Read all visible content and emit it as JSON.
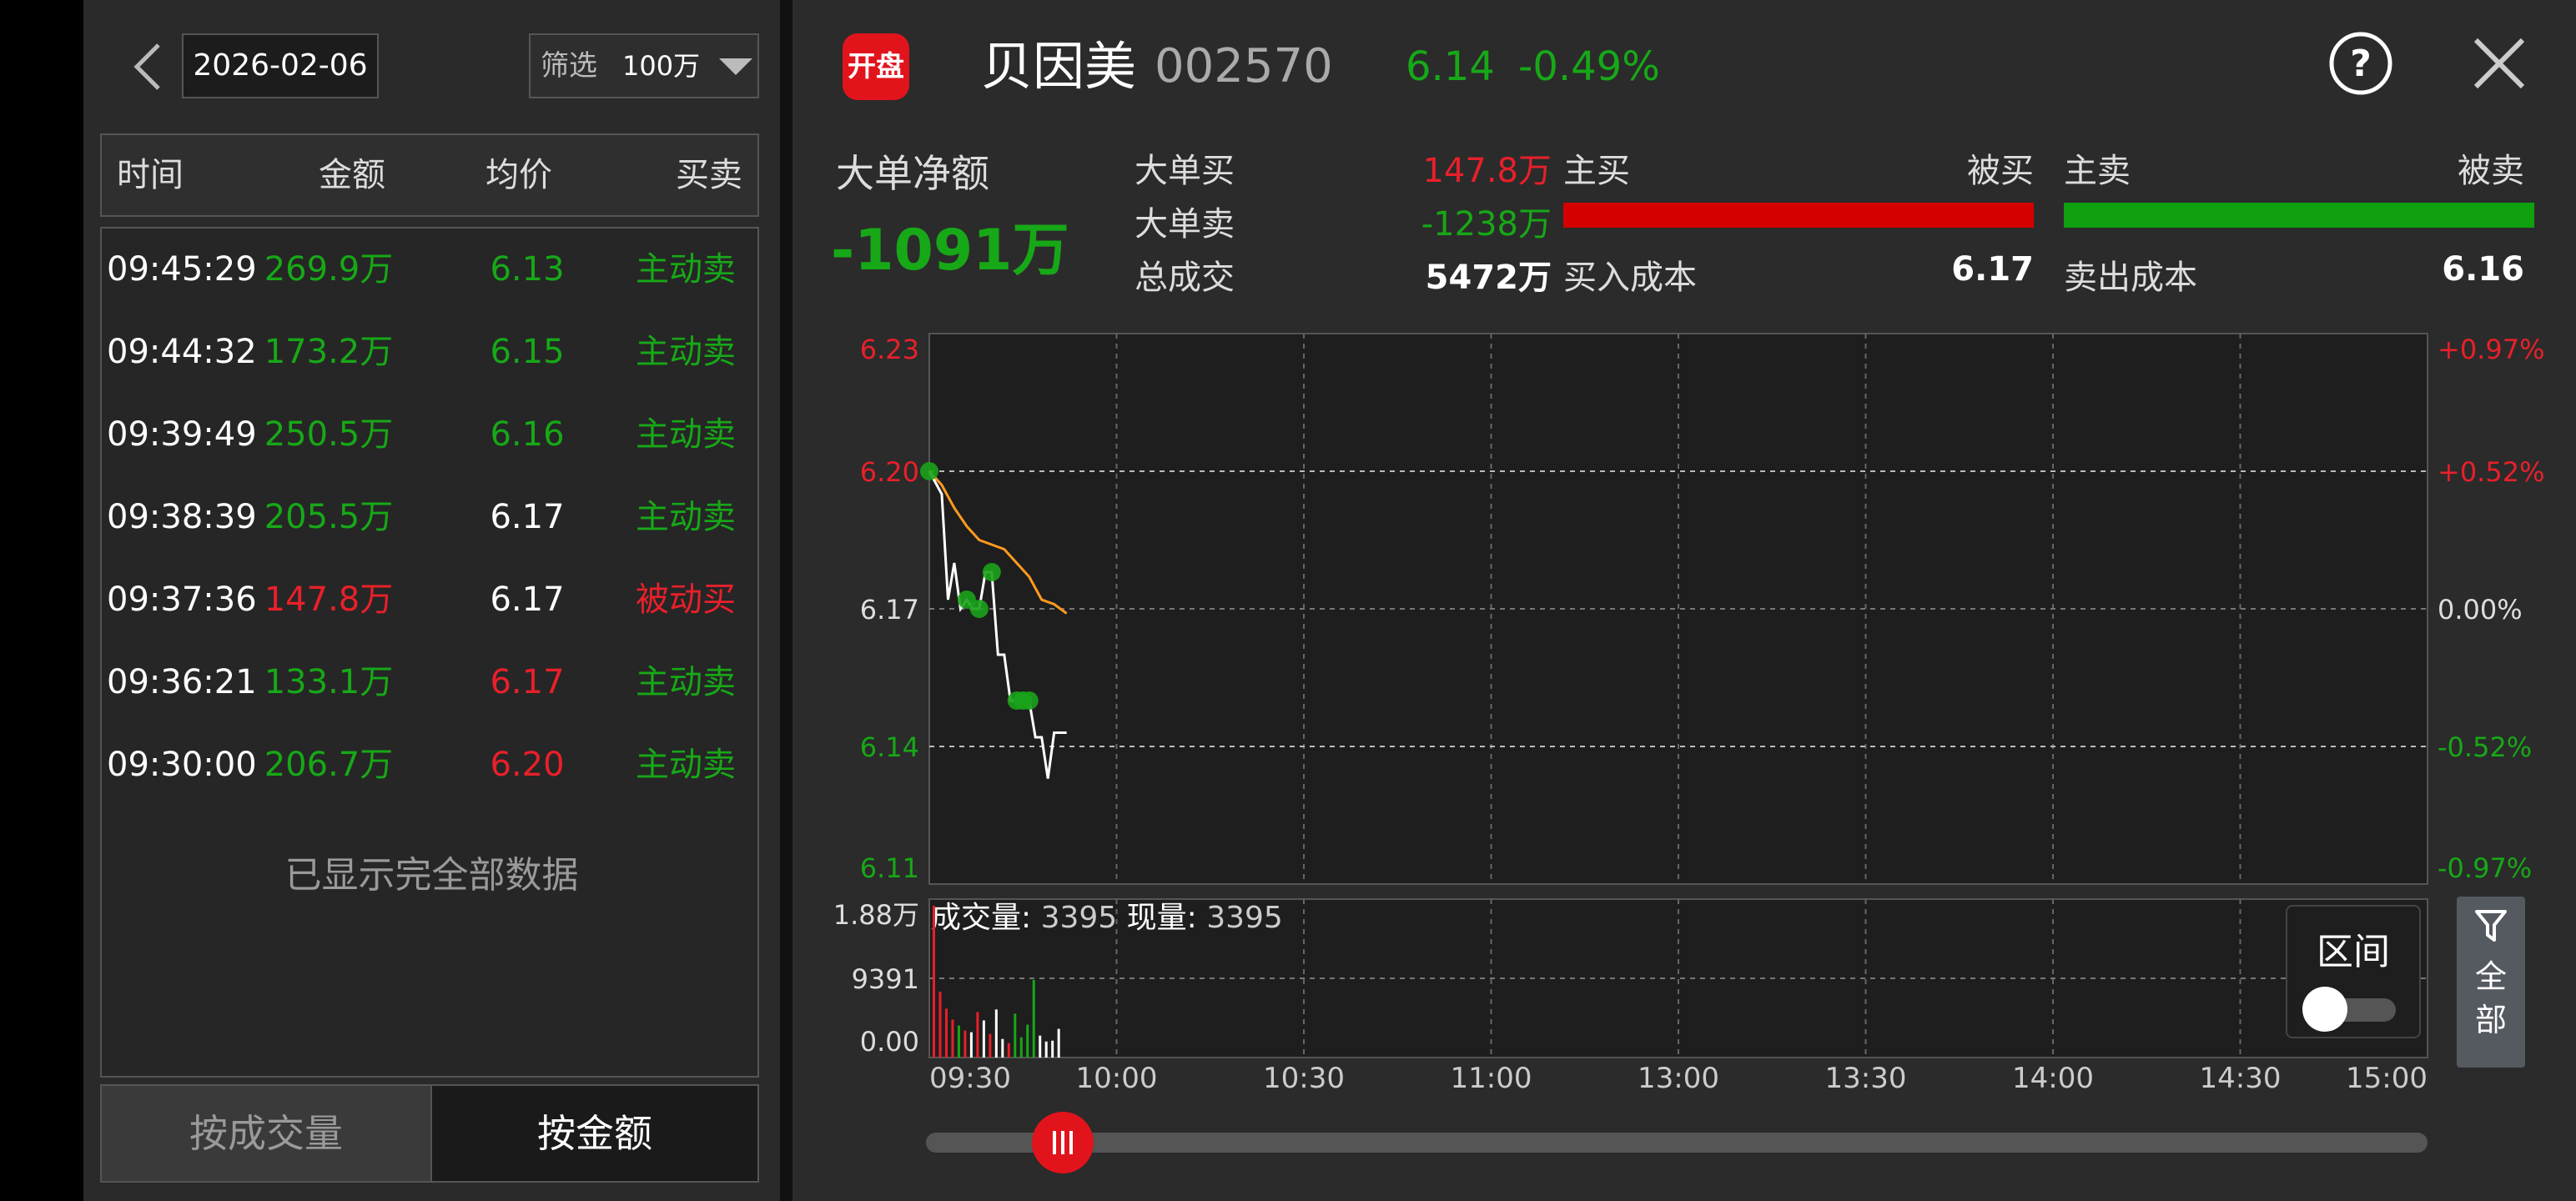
{
  "left": {
    "date": "2026-02-06",
    "filter_label": "筛选",
    "filter_value": "100万",
    "columns": [
      "时间",
      "金额",
      "均价",
      "买卖"
    ],
    "rows": [
      {
        "time": "09:45:29",
        "amount": "269.9万",
        "avg": "6.13",
        "side": "主动卖",
        "amount_color": "#17a817",
        "avg_color": "#17a817",
        "side_color": "#17a817"
      },
      {
        "time": "09:44:32",
        "amount": "173.2万",
        "avg": "6.15",
        "side": "主动卖",
        "amount_color": "#17a817",
        "avg_color": "#17a817",
        "side_color": "#17a817"
      },
      {
        "time": "09:39:49",
        "amount": "250.5万",
        "avg": "6.16",
        "side": "主动卖",
        "amount_color": "#17a817",
        "avg_color": "#17a817",
        "side_color": "#17a817"
      },
      {
        "time": "09:38:39",
        "amount": "205.5万",
        "avg": "6.17",
        "side": "主动卖",
        "amount_color": "#17a817",
        "avg_color": "#ffffff",
        "side_color": "#17a817"
      },
      {
        "time": "09:37:36",
        "amount": "147.8万",
        "avg": "6.17",
        "side": "被动买",
        "amount_color": "#e8202a",
        "avg_color": "#ffffff",
        "side_color": "#e8202a"
      },
      {
        "time": "09:36:21",
        "amount": "133.1万",
        "avg": "6.17",
        "side": "主动卖",
        "amount_color": "#17a817",
        "avg_color": "#e8202a",
        "side_color": "#17a817"
      },
      {
        "time": "09:30:00",
        "amount": "206.7万",
        "avg": "6.20",
        "side": "主动卖",
        "amount_color": "#17a817",
        "avg_color": "#e8202a",
        "side_color": "#17a817"
      }
    ],
    "end_note": "已显示完全部数据",
    "btn_volume": "按成交量",
    "btn_amount": "按金额"
  },
  "header": {
    "logo_text": "开盘",
    "name": "贝因美",
    "code": "002570",
    "price": "6.14",
    "change": "-0.49%",
    "help_icon": "question-circle-icon",
    "close_icon": "close-icon"
  },
  "summary": {
    "net_label": "大单净额",
    "net_value": "-1091万",
    "big_buy_label": "大单买",
    "big_buy_value": "147.8万",
    "big_sell_label": "大单卖",
    "big_sell_value": "-1238万",
    "total_label": "总成交",
    "total_value": "5472万",
    "active_buy_label": "主买",
    "passive_buy_label": "被买",
    "active_sell_label": "主卖",
    "passive_sell_label": "被卖",
    "buy_cost_label": "买入成本",
    "buy_cost_value": "6.17",
    "sell_cost_label": "卖出成本",
    "sell_cost_value": "6.16",
    "colors": {
      "red": "#e8202a",
      "green": "#17a817"
    }
  },
  "chart_data": {
    "type": "line",
    "y_ticks": [
      "6.23",
      "6.20",
      "6.17",
      "6.14",
      "6.11"
    ],
    "y_ticks_pct": [
      "+0.97%",
      "+0.52%",
      "0.00%",
      "-0.52%",
      "-0.97%"
    ],
    "ylim": [
      6.11,
      6.23
    ],
    "x_ticks": [
      "09:30",
      "10:00",
      "10:30",
      "11:00",
      "13:00",
      "13:30",
      "14:00",
      "14:30",
      "15:00"
    ],
    "price_series": {
      "x_min": [
        0,
        2,
        3,
        4,
        5,
        6,
        7,
        8,
        9,
        10,
        11,
        12,
        13,
        14,
        15,
        16,
        17,
        18,
        19,
        20,
        21,
        22
      ],
      "values": [
        6.2,
        6.195,
        6.172,
        6.18,
        6.17,
        6.172,
        6.17,
        6.17,
        6.178,
        6.178,
        6.16,
        6.16,
        6.15,
        6.15,
        6.15,
        6.15,
        6.142,
        6.142,
        6.133,
        6.143,
        6.143,
        6.143
      ]
    },
    "avg_series": {
      "x_min": [
        0,
        2,
        4,
        6,
        8,
        10,
        12,
        14,
        16,
        18,
        20,
        22
      ],
      "values": [
        6.2,
        6.197,
        6.192,
        6.188,
        6.185,
        6.184,
        6.183,
        6.18,
        6.177,
        6.172,
        6.171,
        6.169
      ]
    },
    "trade_markers_x_min": [
      0,
      6,
      8,
      10,
      14,
      15,
      16
    ]
  },
  "volume_chart": {
    "label_volume": "成交量:",
    "volume_value": "3395",
    "label_current": "现量:",
    "current_value": "3395",
    "y_ticks": [
      "1.88万",
      "9391",
      "0.00"
    ],
    "ymax": 18782,
    "bars": [
      {
        "x_min": 0,
        "v": 18000,
        "c": "#e8202a"
      },
      {
        "x_min": 1,
        "v": 7800,
        "c": "#e8202a"
      },
      {
        "x_min": 2,
        "v": 5800,
        "c": "#e8202a"
      },
      {
        "x_min": 3,
        "v": 4500,
        "c": "#e8202a"
      },
      {
        "x_min": 4,
        "v": 3800,
        "c": "#17a817"
      },
      {
        "x_min": 5,
        "v": 3200,
        "c": "#e8202a"
      },
      {
        "x_min": 6,
        "v": 3000,
        "c": "#ffffff"
      },
      {
        "x_min": 7,
        "v": 5400,
        "c": "#e8202a"
      },
      {
        "x_min": 8,
        "v": 4400,
        "c": "#ffffff"
      },
      {
        "x_min": 9,
        "v": 2800,
        "c": "#e8202a"
      },
      {
        "x_min": 10,
        "v": 5700,
        "c": "#ffffff"
      },
      {
        "x_min": 11,
        "v": 2200,
        "c": "#ffffff"
      },
      {
        "x_min": 12,
        "v": 1700,
        "c": "#e8202a"
      },
      {
        "x_min": 13,
        "v": 5200,
        "c": "#17a817"
      },
      {
        "x_min": 14,
        "v": 2400,
        "c": "#17a817"
      },
      {
        "x_min": 15,
        "v": 3900,
        "c": "#17a817"
      },
      {
        "x_min": 16,
        "v": 9200,
        "c": "#17a817"
      },
      {
        "x_min": 17,
        "v": 2600,
        "c": "#ffffff"
      },
      {
        "x_min": 18,
        "v": 1900,
        "c": "#ffffff"
      },
      {
        "x_min": 19,
        "v": 2000,
        "c": "#ffffff"
      },
      {
        "x_min": 20,
        "v": 3400,
        "c": "#ffffff"
      }
    ]
  },
  "range_toggle_label": "区间",
  "all_filter": {
    "icon": "filter-icon",
    "label": "全部"
  }
}
